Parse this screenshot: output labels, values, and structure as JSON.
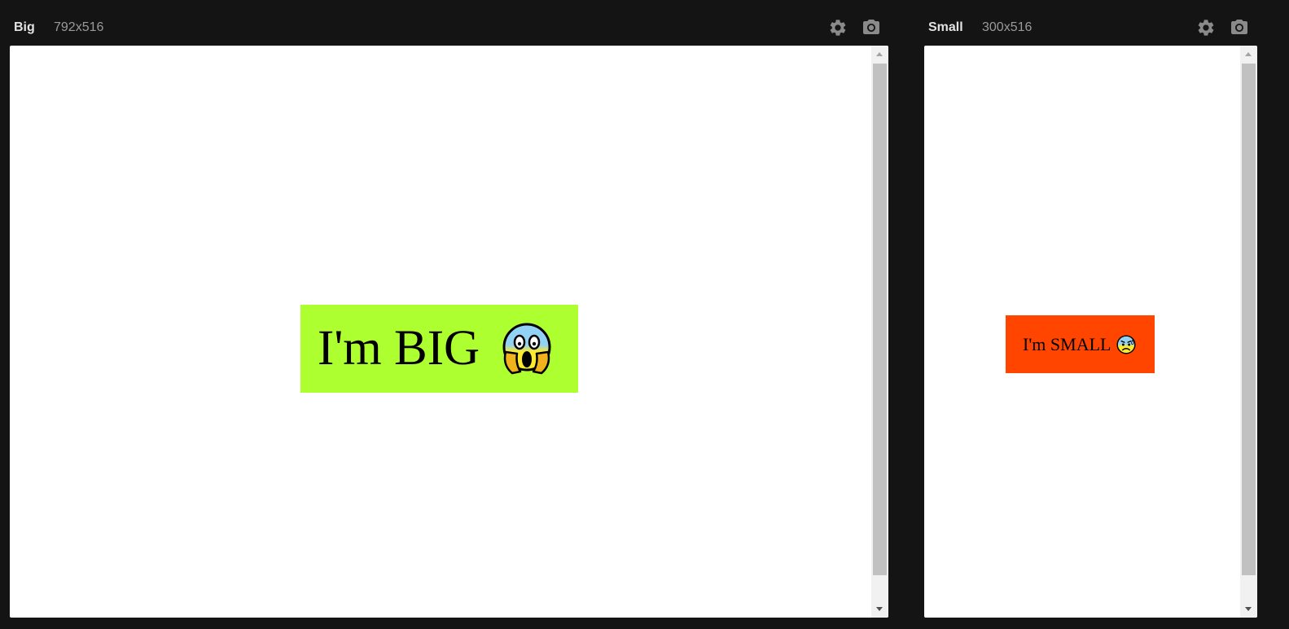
{
  "panels": [
    {
      "title": "Big",
      "size_label": "792x516",
      "content_text": "I'm BIG",
      "content_emoji": "face-screaming-in-fear-icon",
      "box_color": "#adff2f"
    },
    {
      "title": "Small",
      "size_label": "300x516",
      "content_text": "I'm SMALL",
      "content_emoji": "anxious-face-with-sweat-icon",
      "box_color": "#ff4500"
    }
  ],
  "icons": {
    "settings": "gear-icon",
    "screenshot": "camera-icon"
  },
  "colors": {
    "background": "#141414",
    "title": "#e2e2e2",
    "size_label": "#9a9a9a",
    "icon": "#8a8a8a"
  }
}
